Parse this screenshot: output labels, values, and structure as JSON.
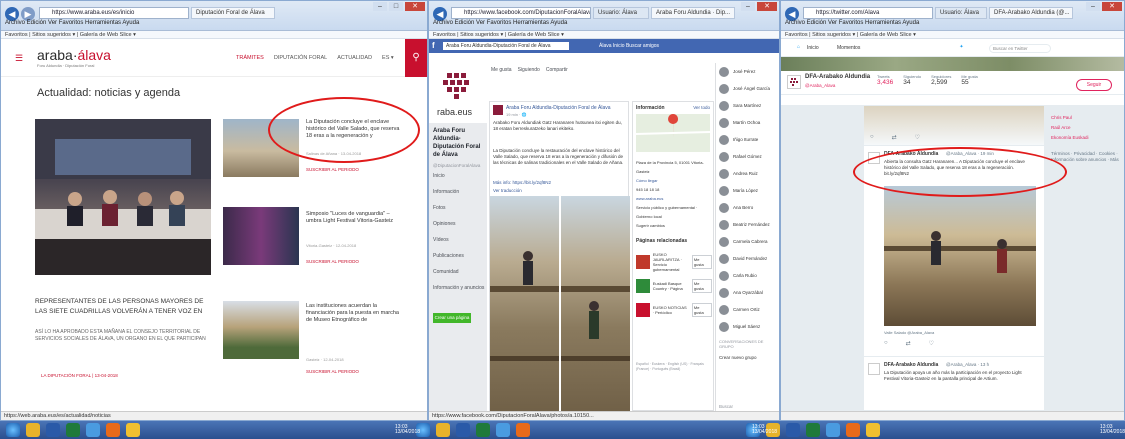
{
  "win1": {
    "url": "https://www.araba.eus/es/inicio",
    "tab_active": "Diputación Foral de Álava",
    "menu": "Archivo  Edición  Ver  Favoritos  Herramientas  Ayuda",
    "favorites": "Favoritos  |  Sitios sugeridos ▾  |  Galería de Web Slice ▾",
    "site_logo": "araba",
    "site_logo_accent": "álava",
    "site_sub": "Foru Aldundia · Diputación Foral",
    "nav": [
      "TRÁMITES",
      "DIPUTACIÓN FORAL",
      "ACTUALIDAD",
      "ES ▾"
    ],
    "page_title": "Actualidad: noticias y agenda",
    "news": [
      {
        "title": "La Diputación concluye el enclave histórico del Valle Salado, que reserva 18 eras a la regeneración y",
        "date": "Salinas de Añana · 13-04-2018",
        "link": "SUSCRIBIR AL PERIODO"
      },
      {
        "title": "Simposio \"Luces de vanguardia\" – umbra Light Festival Vitoria-Gasteiz",
        "date": "Vitoria-Gasteiz · 12-04-2018",
        "link": "SUSCRIBIR AL PERIODO"
      },
      {
        "title": "Las instituciones acuerdan la financiación para la puesta en marcha de Museo Etnográfico de",
        "date": "Gasteiz · 12-04-2018",
        "link": "SUSCRIBIR AL PERIODO"
      }
    ],
    "headline_big": "REPRESENTANTES DE LAS PERSONAS MAYORES DE LAS SIETE CUADRILLAS VOLVERÁN A TENER VOZ EN",
    "headline_sub": "ASÍ LO HA APROBADO ESTA MAÑANA EL CONSEJO TERRITORIAL DE SERVICIOS SOCIALES DE ÁLAVA, UN ORGANO EN EL QUE PARTICIPAN",
    "headline_link": "LA DIPUTACIÓN FORAL | 13-04-2018",
    "status": "https://web.araba.eus/es/actualidad/noticias"
  },
  "win2": {
    "url": "https://www.facebook.com/DiputacionForalAlava/",
    "tab_active": "Araba Foru Aldundia · Dip...",
    "tab2": "Usuario: Álava",
    "menu": "Archivo  Edición  Ver  Favoritos  Herramientas  Ayuda",
    "favorites": "Favoritos  |  Sitios sugeridos ▾  |  Galería de Web Slice ▾",
    "search": "Araba Foru Aldundia-Diputación Foral de Álava",
    "toolbar": "Álava  Inicio  Buscar amigos",
    "page_name": "Araba Foru Aldundia-Diputación Foral de Álava",
    "page_handle": "@DiputacionForalAlava",
    "logo_text": "raba.eus",
    "actions": [
      "Me gusta",
      "Siguiendo",
      "Compartir"
    ],
    "side_nav": [
      "Inicio",
      "Información",
      "Fotos",
      "Opiniones",
      "Vídeos",
      "Publicaciones",
      "Comunidad",
      "Información y anuncios"
    ],
    "cta": "Crear una página",
    "post_author": "Araba Foru Aldundia-Diputación Foral de Álava",
    "post_time": "19 min · 🌐",
    "post_text_eu": "Arabako Foru Aldundiak Gatz Haranaren hutsunea itxi egiten du, 18 eratan berreskuratzeko lanari ekiteko.",
    "post_text_es": "La Diputación concluye la restauración del enclave histórico del Valle Salado, que reserva 18 eras a la regeneración y difusión de las técnicas de salinas tradicionales en el Valle Salado de Añana.",
    "post_link": "Más info: https://bit.ly/2qf8N2",
    "post_more": "Ver traducción",
    "info_title": "Información",
    "info_more": "Ver todo",
    "info_items": [
      "Plaza de la Provincia 5, 01001 Vitoria-Gasteiz",
      "Cómo llegar",
      "945 18 18 18",
      "www.araba.eus",
      "Servicio público y gubernamental · Gobierno local",
      "Sugerir cambios"
    ],
    "related_title": "Páginas relacionadas",
    "related": [
      "EUSKO JAURLARITZA · Servicio gubernamental",
      "Euskadi Basque Country · Página",
      "EUSKO NOTICIAS · Periódico"
    ],
    "like": "Me gusta",
    "footer": "Español · Euskera · English (US) · Français (France) · Português (Brasil)",
    "friends": [
      "José Pérez",
      "José Ángel García",
      "Sara Martínez",
      "Martín Ochoa",
      "Iñigo Iturrate",
      "Rafael Gómez",
      "Andrea Ruiz",
      "María López",
      "Ana Berro",
      "Beatriz Fernández",
      "Carmela Cabrera",
      "David Fernández",
      "Carla Rubio",
      "Ana Oyarzábal",
      "Carmen Ortiz",
      "Miguel Sáenz"
    ],
    "chat_header": "CONVERSACIONES DE GRUPO",
    "chat_create": "Crear nuevo grupo",
    "chat_search": "Buscar",
    "status": "https://www.facebook.com/DiputacionForalAlava/photos/a.10150..."
  },
  "win3": {
    "url": "https://twitter.com/Alava",
    "tab_active": "DFA-Arabako Aldundia (@...",
    "tab2": "Usuario: Álava",
    "menu": "Archivo  Edición  Ver  Favoritos  Herramientas  Ayuda",
    "favorites": "Favoritos  |  Sitios sugeridos ▾  |  Galería de Web Slice ▾",
    "nav": [
      "Inicio",
      "Momentos"
    ],
    "search": "Buscar en Twitter",
    "account_name": "DFA-Arabako Aldundia",
    "account_handle": "@Araba_Alava",
    "stats": [
      {
        "label": "Tweets",
        "value": "3,436"
      },
      {
        "label": "Siguiendo",
        "value": "34"
      },
      {
        "label": "Seguidores",
        "value": "2,599"
      },
      {
        "label": "Me gusta",
        "value": "55"
      }
    ],
    "follow": "Seguir",
    "tweet_author": "DFA-Arabako Aldundia",
    "tweet_handle": "@Araba_Alava · 19 min",
    "tweet_text": "Abierta la consulta Gatz Haranaren... A Diputación concluye el enclave histórico del Valle Salado, que reserva 18 eras a la regeneración. bit.ly/2qf8N2",
    "photo_caption": "Valle Salado @Araba_Alava",
    "tweet2_author": "DFA-Arabako Aldundia",
    "tweet2_handle": "@Araba_Alava · 13 h",
    "tweet2_text": "La Diputación apoya un año más la participación en el proyecto Light Festival Vitoria-Gasteiz en la pantalla principal de Artium.",
    "side_names": [
      "Chris Paul",
      "Raúl Arce",
      "Ekonomía Euskadi"
    ],
    "side_note": "Términos · Privacidad · Cookies · Información sobre anuncios · Más",
    "status": ""
  },
  "taskbar": {
    "clock1": "13:03\n13/04/2018",
    "clock2": "13:03\n13/04/2018",
    "clock3": "13:03\n13/04/2018"
  }
}
